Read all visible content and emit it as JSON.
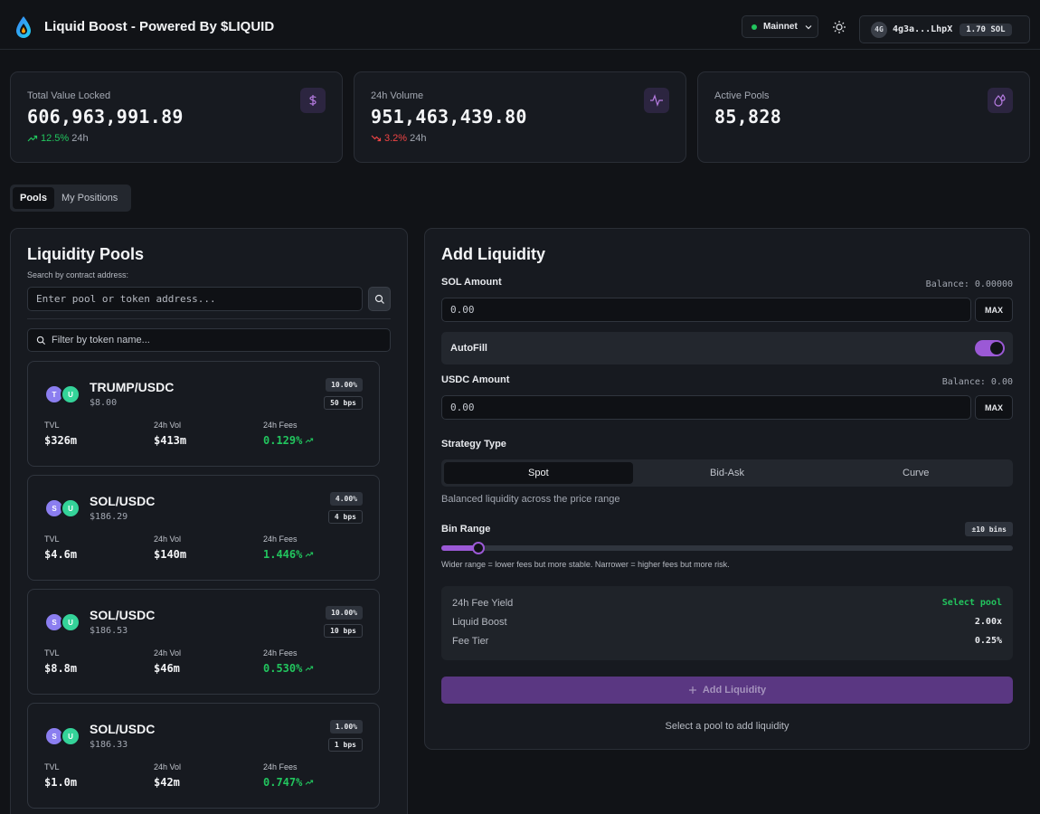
{
  "header": {
    "title": "Liquid Boost - Powered By $LIQUID",
    "network": "Mainnet",
    "wallet": {
      "avatar": "4G",
      "address": "4g3a...LhpX",
      "balance": "1.70 SOL"
    }
  },
  "stats": [
    {
      "label": "Total Value Locked",
      "value": "606,963,991.89",
      "change": "12.5%",
      "direction": "up",
      "period": "24h",
      "icon": "dollar-icon"
    },
    {
      "label": "24h Volume",
      "value": "951,463,439.80",
      "change": "3.2%",
      "direction": "down",
      "period": "24h",
      "icon": "activity-icon"
    },
    {
      "label": "Active Pools",
      "value": "85,828",
      "icon": "droplets-icon"
    }
  ],
  "tabs": [
    {
      "label": "Pools",
      "active": true
    },
    {
      "label": "My Positions",
      "active": false
    }
  ],
  "pools_panel": {
    "title": "Liquidity Pools",
    "search_label": "Search by contract address:",
    "search_placeholder": "Enter pool or token address...",
    "filter_placeholder": "Filter by token name...",
    "metric_labels": {
      "tvl": "TVL",
      "vol": "24h Vol",
      "fees": "24h Fees"
    },
    "pools": [
      {
        "pair": "TRUMP/USDC",
        "token_a": "T",
        "token_b": "U",
        "price": "$8.00",
        "pct": "10.00%",
        "bps": "50 bps",
        "tvl": "$326m",
        "vol": "$413m",
        "fees": "0.129%"
      },
      {
        "pair": "SOL/USDC",
        "token_a": "S",
        "token_b": "U",
        "price": "$186.29",
        "pct": "4.00%",
        "bps": "4 bps",
        "tvl": "$4.6m",
        "vol": "$140m",
        "fees": "1.446%"
      },
      {
        "pair": "SOL/USDC",
        "token_a": "S",
        "token_b": "U",
        "price": "$186.53",
        "pct": "10.00%",
        "bps": "10 bps",
        "tvl": "$8.8m",
        "vol": "$46m",
        "fees": "0.530%"
      },
      {
        "pair": "SOL/USDC",
        "token_a": "S",
        "token_b": "U",
        "price": "$186.33",
        "pct": "1.00%",
        "bps": "1 bps",
        "tvl": "$1.0m",
        "vol": "$42m",
        "fees": "0.747%"
      }
    ]
  },
  "add_panel": {
    "title": "Add Liquidity",
    "sol": {
      "label": "SOL Amount",
      "balance": "Balance: 0.00000",
      "placeholder": "0.00",
      "max": "MAX"
    },
    "autofill": {
      "label": "AutoFill",
      "on": true
    },
    "usdc": {
      "label": "USDC Amount",
      "balance": "Balance: 0.00",
      "placeholder": "0.00",
      "max": "MAX"
    },
    "strategy": {
      "label": "Strategy Type",
      "options": [
        "Spot",
        "Bid-Ask",
        "Curve"
      ],
      "selected": "Spot",
      "description": "Balanced liquidity across the price range"
    },
    "bin_range": {
      "label": "Bin Range",
      "badge": "±10 bins",
      "fraction": 0.065,
      "hint": "Wider range = lower fees but more stable. Narrower = higher fees but more risk."
    },
    "summary": [
      {
        "key": "24h Fee Yield",
        "value": "Select pool",
        "accent": true
      },
      {
        "key": "Liquid Boost",
        "value": "2.00x"
      },
      {
        "key": "Fee Tier",
        "value": "0.25%"
      }
    ],
    "button": "Add Liquidity",
    "footer": "Select a pool to add liquidity"
  },
  "colors": {
    "accent": "#9b59d6",
    "positive": "#22c55e",
    "negative": "#ef4444",
    "background": "#111317",
    "card": "#171a20"
  }
}
